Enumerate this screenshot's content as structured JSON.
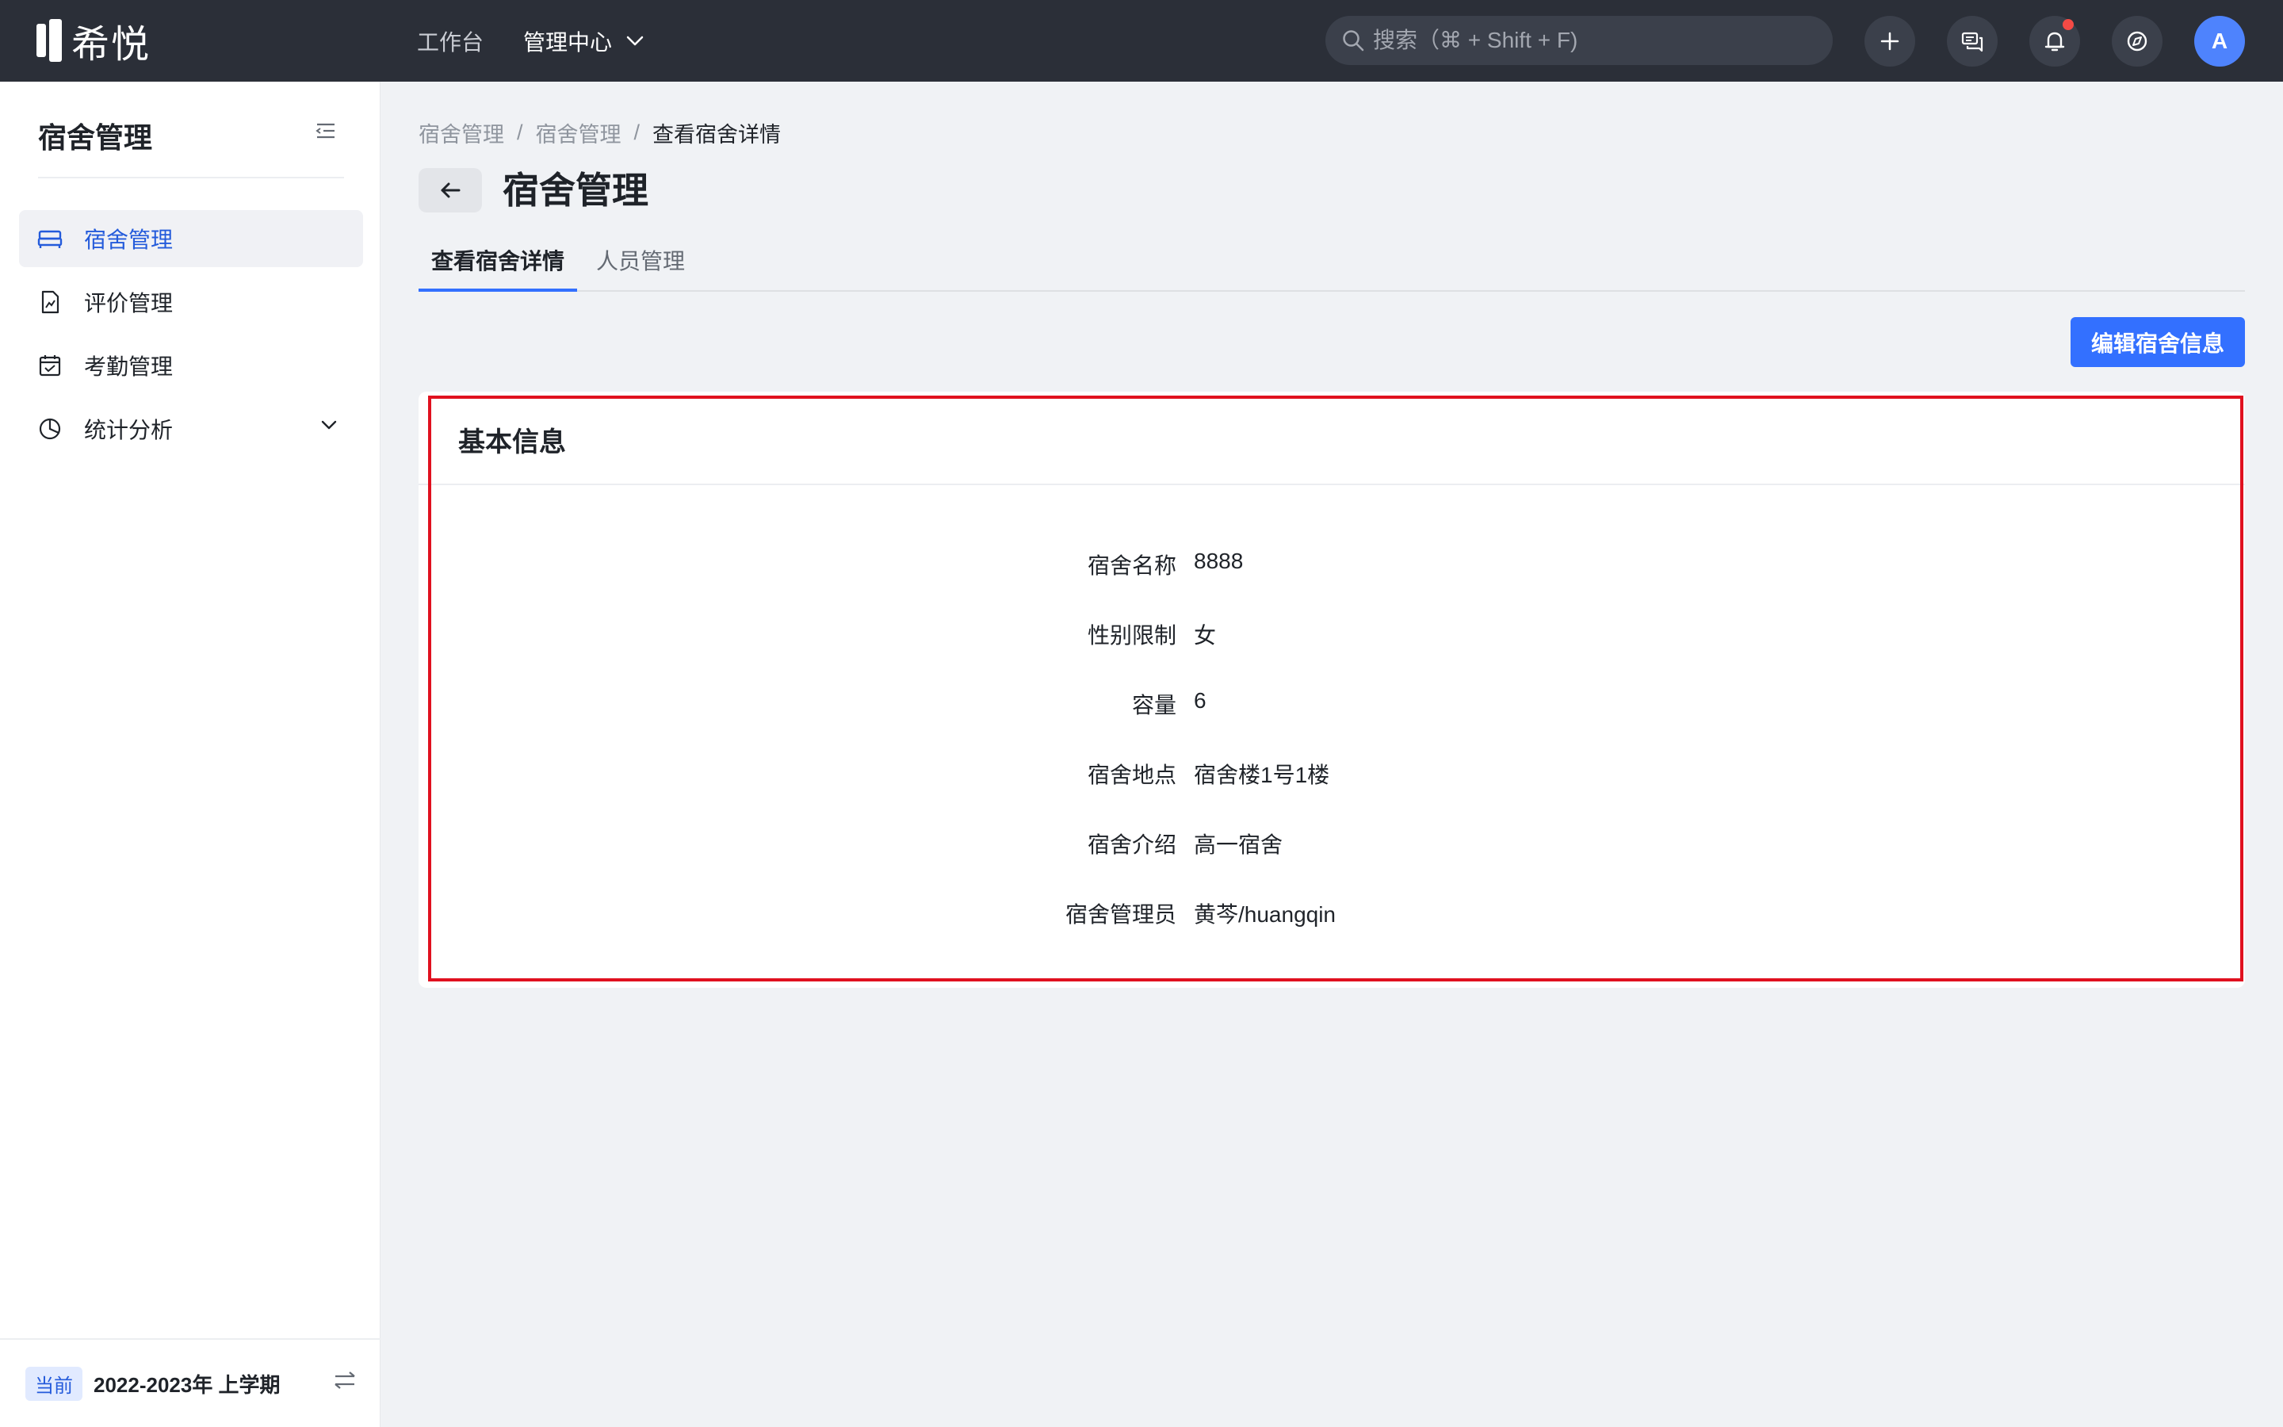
{
  "app": {
    "logo_text": "希悦"
  },
  "topnav": {
    "items": [
      {
        "label": "工作台"
      },
      {
        "label": "管理中心"
      }
    ]
  },
  "search": {
    "placeholder": "搜索（⌘ + Shift + F)"
  },
  "user": {
    "avatar_letter": "A"
  },
  "sidebar": {
    "title": "宿舍管理",
    "items": [
      {
        "label": "宿舍管理",
        "icon": "bed-icon"
      },
      {
        "label": "评价管理",
        "icon": "evaluation-icon"
      },
      {
        "label": "考勤管理",
        "icon": "calendar-icon"
      },
      {
        "label": "统计分析",
        "icon": "pie-chart-icon"
      }
    ],
    "footer": {
      "badge": "当前",
      "term": "2022-2023年 上学期"
    }
  },
  "breadcrumb": {
    "items": [
      "宿舍管理",
      "宿舍管理",
      "查看宿舍详情"
    ],
    "separator": "/"
  },
  "page": {
    "title": "宿舍管理"
  },
  "tabs": [
    {
      "label": "查看宿舍详情"
    },
    {
      "label": "人员管理"
    }
  ],
  "actions": {
    "edit_label": "编辑宿舍信息"
  },
  "card": {
    "title": "基本信息",
    "rows": [
      {
        "label": "宿舍名称",
        "value": "8888"
      },
      {
        "label": "性别限制",
        "value": "女"
      },
      {
        "label": "容量",
        "value": "6"
      },
      {
        "label": "宿舍地点",
        "value": "宿舍楼1号1楼"
      },
      {
        "label": "宿舍介绍",
        "value": "高一宿舍"
      },
      {
        "label": "宿舍管理员",
        "value": "黄芩/huangqin"
      }
    ]
  },
  "colors": {
    "topbar": "#2b2f38",
    "accent": "#3370ff",
    "active_text": "#245bdb",
    "highlight_border": "#e0111f",
    "notification_dot": "#f54a45"
  }
}
